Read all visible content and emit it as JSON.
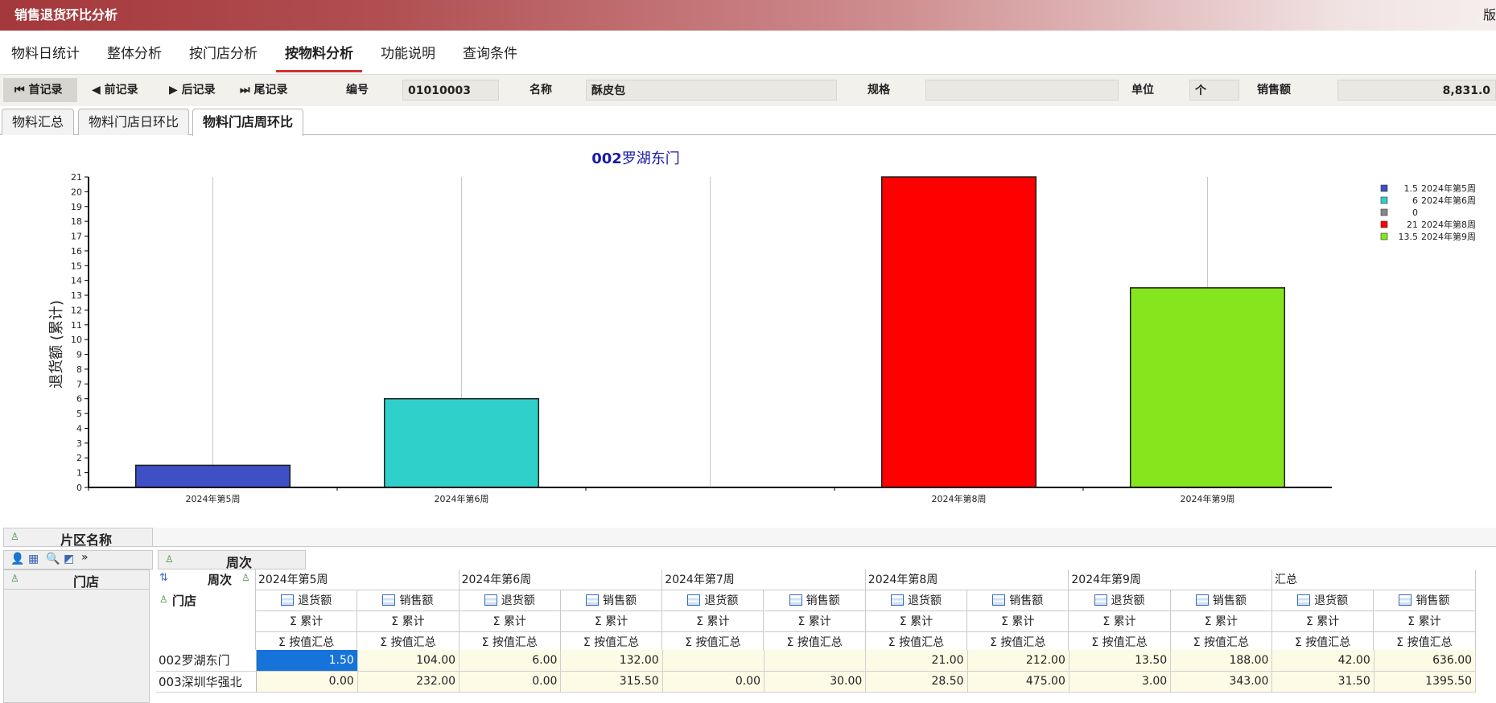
{
  "window": {
    "title": "销售退货环比分析",
    "right_label": "版"
  },
  "nav_tabs": [
    {
      "label": "物料日统计"
    },
    {
      "label": "整体分析"
    },
    {
      "label": "按门店分析"
    },
    {
      "label": "按物料分析",
      "active": true
    },
    {
      "label": "功能说明"
    },
    {
      "label": "查询条件"
    }
  ],
  "toolbar": {
    "first": "首记录",
    "prev": "前记录",
    "next": "后记录",
    "last": "尾记录",
    "code_label": "编号",
    "code_value": "01010003",
    "name_label": "名称",
    "name_value": "酥皮包",
    "spec_label": "规格",
    "spec_value": "",
    "unit_label": "单位",
    "unit_value": "个",
    "sales_label": "销售额",
    "sales_value": "8,831.0"
  },
  "sub_tabs": [
    {
      "label": "物料汇总"
    },
    {
      "label": "物料门店日环比"
    },
    {
      "label": "物料门店周环比",
      "active": true
    }
  ],
  "chart_data": {
    "type": "bar",
    "title": "002罗湖东门",
    "title_prefix": "002",
    "title_rest": "罗湖东门",
    "ylabel": "退货额 (累计)",
    "ylim": [
      0,
      21
    ],
    "grid": true,
    "categories": [
      "2024年第5周",
      "2024年第6周",
      "2024年第7周",
      "2024年第8周",
      "2024年第9周"
    ],
    "values": [
      1.5,
      6,
      0,
      21,
      13.5
    ],
    "colors": [
      "#3f4fc5",
      "#2ed0c9",
      "#888888",
      "#ff0000",
      "#86e61d"
    ],
    "legend_position": "top-right",
    "legend": [
      {
        "value": "1.5",
        "label": "2024年第5周"
      },
      {
        "value": "6",
        "label": "2024年第6周"
      },
      {
        "value": "0",
        "label": ""
      },
      {
        "value": "21",
        "label": "2024年第8周"
      },
      {
        "value": "13.5",
        "label": "2024年第9周"
      }
    ]
  },
  "pivot": {
    "region_header": "片区名称",
    "week_header": "周次",
    "store_header": "门店",
    "weeks": [
      "2024年第5周",
      "2024年第6周",
      "2024年第7周",
      "2024年第8周",
      "2024年第9周",
      "汇总"
    ],
    "measures": [
      "退货额",
      "销售额"
    ],
    "sum_label": "累计",
    "agg_label": "按值汇总",
    "rows": [
      {
        "store": "002罗湖东门",
        "cells": [
          "1.50",
          "104.00",
          "6.00",
          "132.00",
          "",
          "",
          "21.00",
          "212.00",
          "13.50",
          "188.00",
          "42.00",
          "636.00"
        ]
      },
      {
        "store": "003深圳华强北",
        "cells": [
          "0.00",
          "232.00",
          "0.00",
          "315.50",
          "0.00",
          "30.00",
          "28.50",
          "475.00",
          "3.00",
          "343.00",
          "31.50",
          "1395.50"
        ]
      }
    ]
  }
}
